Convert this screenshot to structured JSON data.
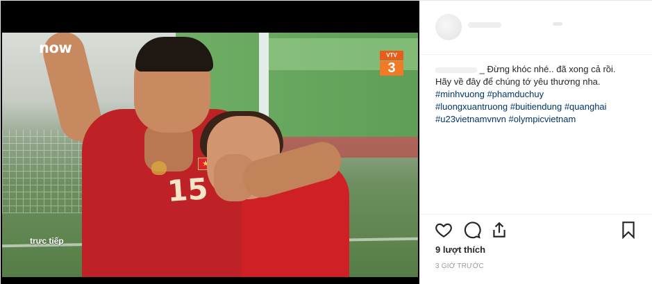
{
  "video": {
    "brand_logo": "now",
    "channel_badge_top": "VTV",
    "channel_badge_number": "3",
    "live_label": "trực tiếp",
    "jersey_number": "15"
  },
  "post": {
    "caption_line1": "_ Đừng khóc nhé.. đã xong cả rồi.",
    "caption_line2": "Hãy về đây để chúng tớ yêu thương nha.",
    "hashtags_line1": [
      "#minhvuong",
      "#phamduchuy"
    ],
    "hashtags_line2": [
      "#luongxuantruong",
      "#buitiendung",
      "#quanghai"
    ],
    "hashtags_line3": [
      "#u23vietnamvnvn",
      "#olympicvietnam"
    ],
    "likes_text": "9 lượt thích",
    "timestamp": "3 GIỜ TRƯỚC"
  },
  "icons": {
    "like": "heart-icon",
    "comment": "comment-icon",
    "share": "share-icon",
    "save": "bookmark-icon"
  },
  "colors": {
    "hashtag": "#003569",
    "jersey_red": "#bf2226",
    "channel_orange": "#f07a25"
  }
}
